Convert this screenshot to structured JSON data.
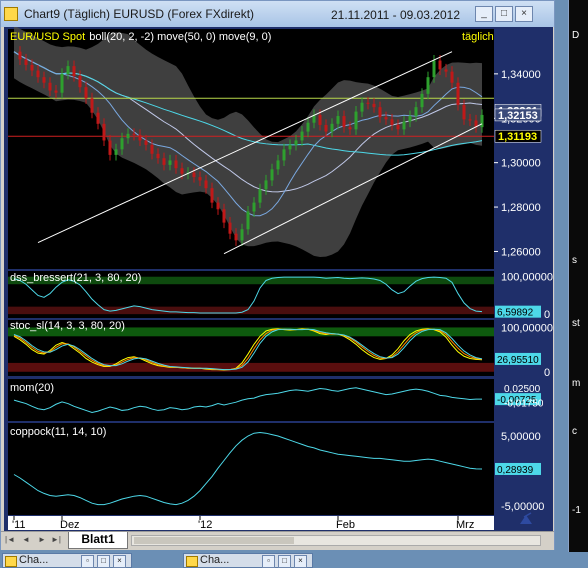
{
  "window": {
    "title": "Chart9 (Täglich)  EURUSD (Forex FXdirekt)",
    "date_range": "21.11.2011 - 09.03.2012",
    "min_label": "_",
    "max_label": "□",
    "close_label": "×"
  },
  "tabs": {
    "sheet": "Blatt1",
    "first": "|◄",
    "prev": "◄",
    "next": "►",
    "last": "►|"
  },
  "taskbar": [
    {
      "label": "Cha...",
      "min": "▫",
      "max": "□",
      "close": "×"
    },
    {
      "label": "Cha...",
      "min": "▫",
      "max": "□",
      "close": "×"
    }
  ],
  "right_window": {
    "labels": [
      "D",
      "s",
      "st",
      "m",
      "c",
      "-1"
    ]
  },
  "colors": {
    "bg": "#000000",
    "frame": "#1f2f6a",
    "up": "#2ea02e",
    "down": "#c01818",
    "band": "#4a4a4a",
    "ma50": "#4dd8e8",
    "boll_mid": "#c0c8e8",
    "ma9": "#7aa8e0",
    "channel": "#ffffff",
    "support": "#d02020",
    "resistance": "#b8d84a"
  },
  "chart_data": [
    {
      "type": "candlestick",
      "title": "EUR/USD Spot",
      "indicators": "boll(20, 2, -2) move(50, 0) move(9, 0)",
      "timeframe_label": "täglich",
      "y_ticks": [
        "1,34000",
        "1,32000",
        "1,30000",
        "1,28000",
        "1,26000"
      ],
      "y_tick_values": [
        1.34,
        1.32,
        1.3,
        1.28,
        1.26
      ],
      "ylim": [
        1.253,
        1.353
      ],
      "x_ticks": [
        {
          "label": "'11",
          "index": 0
        },
        {
          "label": "Dez",
          "index": 8
        },
        {
          "label": "'12",
          "index": 31
        },
        {
          "label": "Feb",
          "index": 54
        },
        {
          "label": "Mrz",
          "index": 74
        }
      ],
      "price_labels": [
        {
          "text": "1,32361",
          "value": 1.3236,
          "color": "#ffffff"
        },
        {
          "text": "1,32153",
          "value": 1.3215,
          "color": "#ffffff"
        },
        {
          "text": "1,31193",
          "value": 1.3119,
          "color": "#ffff00"
        }
      ],
      "horizontal_lines": [
        {
          "name": "resistance",
          "value": 1.329,
          "color": "#b8d84a"
        },
        {
          "name": "support",
          "value": 1.3119,
          "color": "#d02020"
        }
      ],
      "closes": [
        1.35,
        1.3465,
        1.344,
        1.3415,
        1.3385,
        1.336,
        1.3325,
        1.3315,
        1.34,
        1.3435,
        1.339,
        1.334,
        1.329,
        1.3225,
        1.3175,
        1.31,
        1.3035,
        1.306,
        1.311,
        1.313,
        1.3125,
        1.31,
        1.308,
        1.304,
        1.302,
        1.299,
        1.301,
        1.2975,
        1.295,
        1.2955,
        1.2935,
        1.292,
        1.2885,
        1.282,
        1.279,
        1.273,
        1.268,
        1.265,
        1.27,
        1.278,
        1.282,
        1.288,
        1.292,
        1.297,
        1.301,
        1.306,
        1.308,
        1.31,
        1.314,
        1.318,
        1.3215,
        1.317,
        1.314,
        1.3175,
        1.321,
        1.316,
        1.315,
        1.323,
        1.327,
        1.3265,
        1.325,
        1.3205,
        1.3195,
        1.317,
        1.315,
        1.3185,
        1.321,
        1.325,
        1.331,
        1.3385,
        1.346,
        1.342,
        1.341,
        1.336,
        1.326,
        1.3195,
        1.319,
        1.316,
        1.3215
      ]
    },
    {
      "type": "line",
      "title": "dss_bressert(21, 3, 80, 20)",
      "value_label": "6,59892",
      "right_tick": "100,00000",
      "zero_tick": "0",
      "ylim": [
        -5,
        110
      ],
      "values": [
        95,
        90,
        80,
        65,
        50,
        45,
        55,
        72,
        85,
        92,
        88,
        78,
        60,
        40,
        25,
        12,
        8,
        10,
        14,
        18,
        22,
        20,
        16,
        12,
        10,
        8,
        6,
        6,
        5,
        4,
        4,
        3,
        3,
        3,
        3,
        3,
        3,
        3,
        5,
        12,
        35,
        70,
        90,
        96,
        98,
        99,
        99,
        99,
        99,
        99,
        99,
        98,
        96,
        97,
        98,
        96,
        95,
        96,
        97,
        96,
        94,
        90,
        80,
        65,
        55,
        60,
        75,
        88,
        95,
        98,
        99,
        98,
        96,
        85,
        55,
        30,
        15,
        8,
        6.6
      ]
    },
    {
      "type": "line",
      "title": "stoc_sl(14, 3, 3, 80, 20)",
      "value_label": "26,95510",
      "right_tick": "100,00000",
      "zero_tick": "0",
      "ylim": [
        -5,
        110
      ],
      "series": [
        {
          "name": "k",
          "color": "#ffff00",
          "values": [
            80,
            72,
            62,
            50,
            42,
            40,
            48,
            60,
            66,
            62,
            52,
            42,
            30,
            22,
            16,
            12,
            12,
            18,
            26,
            32,
            34,
            30,
            24,
            18,
            14,
            12,
            10,
            10,
            9,
            8,
            8,
            8,
            6,
            5,
            5,
            4,
            5,
            8,
            20,
            40,
            62,
            80,
            92,
            96,
            97,
            95,
            94,
            95,
            97,
            96,
            92,
            86,
            84,
            86,
            85,
            80,
            72,
            62,
            50,
            40,
            32,
            28,
            30,
            38,
            52,
            70,
            84,
            92,
            96,
            97,
            95,
            90,
            78,
            60,
            45,
            35,
            30,
            28,
            27
          ]
        },
        {
          "name": "d",
          "color": "#ff8c00",
          "values": [
            82,
            76,
            66,
            55,
            46,
            42,
            45,
            55,
            63,
            63,
            56,
            46,
            36,
            26,
            19,
            14,
            13,
            15,
            22,
            28,
            32,
            31,
            27,
            21,
            16,
            13,
            11,
            10,
            9,
            8,
            8,
            8,
            7,
            6,
            5,
            5,
            5,
            7,
            14,
            30,
            52,
            72,
            86,
            94,
            96,
            96,
            95,
            95,
            96,
            96,
            94,
            89,
            86,
            85,
            85,
            82,
            76,
            67,
            56,
            46,
            37,
            31,
            30,
            34,
            45,
            61,
            77,
            88,
            94,
            96,
            96,
            93,
            84,
            68,
            53,
            41,
            34,
            30,
            28
          ]
        },
        {
          "name": "slow",
          "color": "#4dd8e8",
          "values": [
            84,
            79,
            70,
            59,
            50,
            45,
            44,
            50,
            58,
            62,
            58,
            50,
            40,
            30,
            22,
            16,
            14,
            14,
            18,
            24,
            29,
            31,
            29,
            24,
            19,
            15,
            12,
            11,
            10,
            9,
            8,
            8,
            8,
            7,
            6,
            5,
            5,
            6,
            10,
            22,
            42,
            64,
            80,
            90,
            95,
            96,
            96,
            95,
            95,
            96,
            95,
            91,
            88,
            86,
            85,
            83,
            78,
            70,
            60,
            50,
            41,
            34,
            31,
            32,
            40,
            54,
            70,
            83,
            91,
            95,
            96,
            95,
            88,
            75,
            60,
            47,
            38,
            32,
            29
          ]
        }
      ]
    },
    {
      "type": "line",
      "title": "mom(20)",
      "value_label": "-0,00725",
      "ticks": [
        "0,02500",
        "-0,01750"
      ],
      "ylim": [
        -0.065,
        0.04
      ],
      "values": [
        -0.01,
        -0.015,
        -0.02,
        -0.028,
        -0.035,
        -0.038,
        -0.032,
        -0.022,
        -0.015,
        -0.02,
        -0.028,
        -0.034,
        -0.04,
        -0.046,
        -0.042,
        -0.036,
        -0.03,
        -0.034,
        -0.04,
        -0.038,
        -0.032,
        -0.028,
        -0.03,
        -0.036,
        -0.04,
        -0.038,
        -0.032,
        -0.034,
        -0.038,
        -0.036,
        -0.03,
        -0.028,
        -0.03,
        -0.026,
        -0.02,
        -0.024,
        -0.02,
        -0.016,
        -0.01,
        -0.006,
        -0.004,
        0.002,
        0.006,
        0.008,
        0.01,
        0.014,
        0.018,
        0.02,
        0.018,
        0.016,
        0.02,
        0.024,
        0.022,
        0.018,
        0.016,
        0.02,
        0.024,
        0.026,
        0.022,
        0.018,
        0.014,
        0.01,
        0.006,
        0.008,
        0.012,
        0.016,
        0.02,
        0.022,
        0.02,
        0.016,
        0.01,
        0.004,
        0.002,
        -0.002,
        -0.004,
        -0.006,
        -0.008,
        -0.007,
        -0.007
      ]
    },
    {
      "type": "line",
      "title": "coppock(11, 14, 10)",
      "value_label": "0,28939",
      "ticks": [
        "5,00000",
        "-5,00000"
      ],
      "ylim": [
        -6,
        6
      ],
      "values": [
        -0.5,
        -1.0,
        -1.6,
        -2.2,
        -2.8,
        -3.2,
        -3.5,
        -3.6,
        -3.5,
        -3.4,
        -3.5,
        -3.8,
        -4.2,
        -4.6,
        -4.8,
        -4.8,
        -4.6,
        -4.3,
        -4.0,
        -3.8,
        -3.6,
        -3.5,
        -3.6,
        -3.9,
        -4.2,
        -4.5,
        -4.7,
        -4.8,
        -4.6,
        -4.2,
        -3.6,
        -2.8,
        -1.8,
        -0.8,
        0.4,
        1.5,
        2.6,
        3.6,
        4.4,
        5.0,
        5.4,
        5.5,
        5.4,
        5.2,
        5.0,
        4.7,
        4.4,
        4.1,
        3.8,
        3.5,
        3.3,
        3.0,
        2.8,
        2.6,
        2.4,
        2.3,
        2.2,
        2.1,
        2.0,
        1.9,
        1.8,
        1.8,
        1.7,
        1.6,
        1.5,
        1.4,
        1.4,
        1.5,
        1.6,
        1.7,
        1.6,
        1.4,
        1.2,
        1.0,
        0.8,
        0.6,
        0.4,
        0.3,
        0.29
      ]
    }
  ]
}
